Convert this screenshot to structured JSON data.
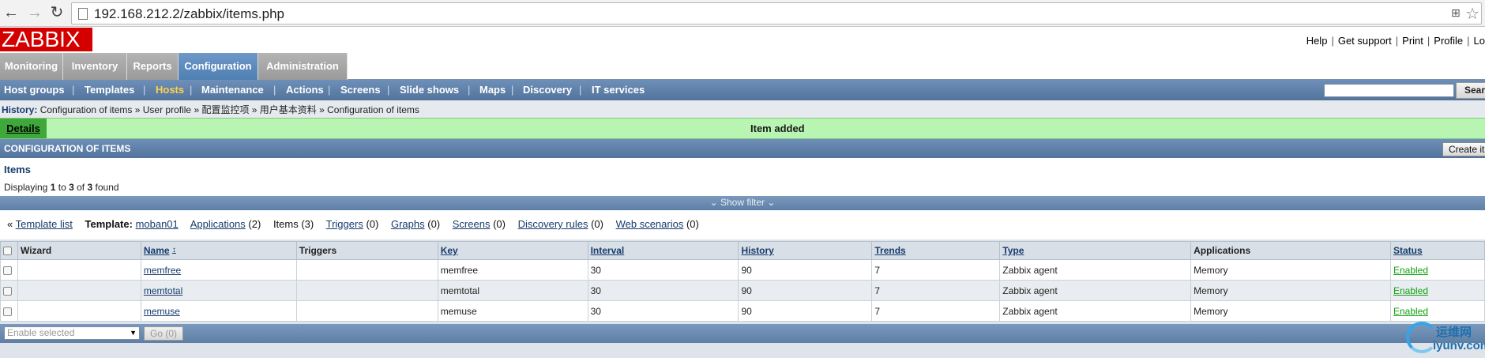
{
  "browser": {
    "url": "192.168.212.2/zabbix/items.php"
  },
  "header": {
    "logo": "ZABBIX",
    "links": [
      "Help",
      "Get support",
      "Print",
      "Profile",
      "Lo"
    ]
  },
  "main_menu": {
    "tabs": [
      {
        "label": "Monitoring",
        "active": false
      },
      {
        "label": "Inventory",
        "active": false
      },
      {
        "label": "Reports",
        "active": false
      },
      {
        "label": "Configuration",
        "active": true
      },
      {
        "label": "Administration",
        "active": false
      }
    ]
  },
  "sub_menu": {
    "items": [
      {
        "label": "Host groups",
        "active": false
      },
      {
        "label": "Templates",
        "active": false
      },
      {
        "label": "Hosts",
        "active": true
      },
      {
        "label": "Maintenance",
        "active": false
      },
      {
        "label": "Actions",
        "active": false
      },
      {
        "label": "Screens",
        "active": false
      },
      {
        "label": "Slide shows",
        "active": false
      },
      {
        "label": "Maps",
        "active": false
      },
      {
        "label": "Discovery",
        "active": false
      },
      {
        "label": "IT services",
        "active": false
      }
    ],
    "search_button": "Sear"
  },
  "history": {
    "label": "History:",
    "trail": "Configuration of items » User profile » 配置监控项 » 用户基本资料 » Configuration of items"
  },
  "message": {
    "details": "Details",
    "text": "Item added"
  },
  "section": {
    "title": "CONFIGURATION OF ITEMS",
    "create_button": "Create it"
  },
  "items": {
    "title": "Items",
    "displaying": "Displaying",
    "from": "1",
    "to_word": "to",
    "to": "3",
    "of_word": "of",
    "total": "3",
    "found": "found"
  },
  "filter": {
    "label": "Show filter"
  },
  "links": {
    "prefix": "«",
    "template_list": "Template list",
    "template_label": "Template:",
    "template_name": "moban01",
    "applications": "Applications",
    "applications_count": "(2)",
    "items_label": "Items (3)",
    "triggers": "Triggers",
    "triggers_count": "(0)",
    "graphs": "Graphs",
    "graphs_count": "(0)",
    "screens": "Screens",
    "screens_count": "(0)",
    "discovery": "Discovery rules",
    "discovery_count": "(0)",
    "web": "Web scenarios",
    "web_count": "(0)"
  },
  "table": {
    "headers": {
      "wizard": "Wizard",
      "name": "Name",
      "triggers": "Triggers",
      "key": "Key",
      "interval": "Interval",
      "history": "History",
      "trends": "Trends",
      "type": "Type",
      "applications": "Applications",
      "status": "Status"
    },
    "rows": [
      {
        "name": "memfree",
        "triggers": "",
        "key": "memfree",
        "interval": "30",
        "history": "90",
        "trends": "7",
        "type": "Zabbix agent",
        "applications": "Memory",
        "status": "Enabled"
      },
      {
        "name": "memtotal",
        "triggers": "",
        "key": "memtotal",
        "interval": "30",
        "history": "90",
        "trends": "7",
        "type": "Zabbix agent",
        "applications": "Memory",
        "status": "Enabled"
      },
      {
        "name": "memuse",
        "triggers": "",
        "key": "memuse",
        "interval": "30",
        "history": "90",
        "trends": "7",
        "type": "Zabbix agent",
        "applications": "Memory",
        "status": "Enabled"
      }
    ]
  },
  "footer": {
    "bulk_action": "Enable selected",
    "go_button": "Go (0)"
  },
  "watermark": {
    "cn": "运维网",
    "en": "iyunv.com"
  },
  "colors": {
    "brand": "#d40000",
    "active_tab": "#4f7fb3",
    "active_submenu": "#ffd24d",
    "success": "#b8f5b3",
    "enabled": "#12a112"
  }
}
